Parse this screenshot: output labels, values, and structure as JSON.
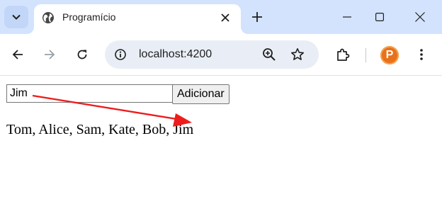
{
  "browser": {
    "tab_title": "Programício",
    "url": "localhost:4200",
    "profile_initial": "P",
    "accent_color": "#d3e3fd"
  },
  "page": {
    "input_value": "Jim",
    "add_button_label": "Adicionar",
    "names_list": "Tom, Alice, Sam, Kate, Bob, Jim",
    "annotation_color": "#ee1c1c"
  }
}
